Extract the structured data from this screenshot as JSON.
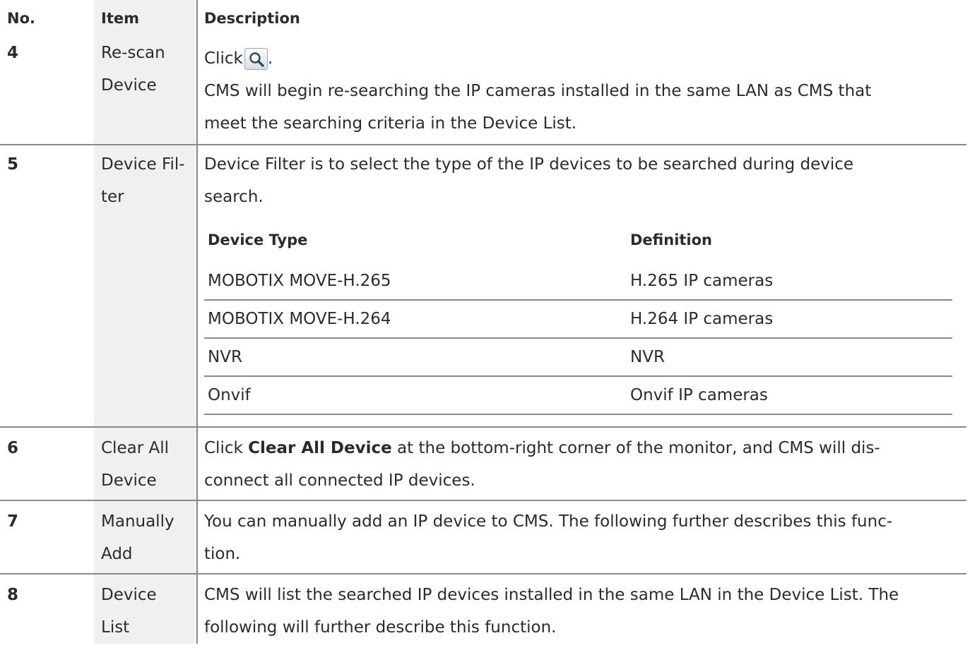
{
  "header": {
    "no": "No.",
    "item": "Item",
    "description": "Description"
  },
  "rows": [
    {
      "no": "4",
      "item": [
        "Re-scan",
        "Device"
      ],
      "click_prefix": "Click",
      "click_suffix": ".",
      "search_icon": "magnifier-icon",
      "desc_lines": [
        "CMS will begin re-searching the IP cameras installed in the same LAN as CMS that",
        "meet the searching criteria in the Device List."
      ]
    },
    {
      "no": "5",
      "item": [
        "Device Fil-",
        "ter"
      ],
      "desc_lines": [
        "Device Filter is to select the type of the IP devices to be searched during device",
        "search."
      ],
      "subtable": {
        "headers": [
          "Device Type",
          "Definition"
        ],
        "rows": [
          [
            "MOBOTIX MOVE-H.265",
            "H.265 IP cameras"
          ],
          [
            "MOBOTIX MOVE-H.264",
            "H.264 IP cameras"
          ],
          [
            "NVR",
            "NVR"
          ],
          [
            "Onvif",
            "Onvif IP cameras"
          ]
        ]
      }
    },
    {
      "no": "6",
      "item": [
        "Clear All",
        "Device"
      ],
      "line1_prefix": "Click ",
      "line1_bold": "Clear All Device",
      "line1_suffix": " at the bottom-right corner of the monitor, and CMS will dis-",
      "line2": "connect all connected IP devices."
    },
    {
      "no": "7",
      "item": [
        "Manually",
        "Add"
      ],
      "desc_lines": [
        "You can manually add an IP device to CMS. The following further describes this func-",
        "tion."
      ]
    },
    {
      "no": "8",
      "item": [
        "Device",
        "List"
      ],
      "desc_lines": [
        "CMS will list the searched IP devices installed in the same LAN in the Device List. The",
        "following will further describe this function."
      ]
    }
  ]
}
